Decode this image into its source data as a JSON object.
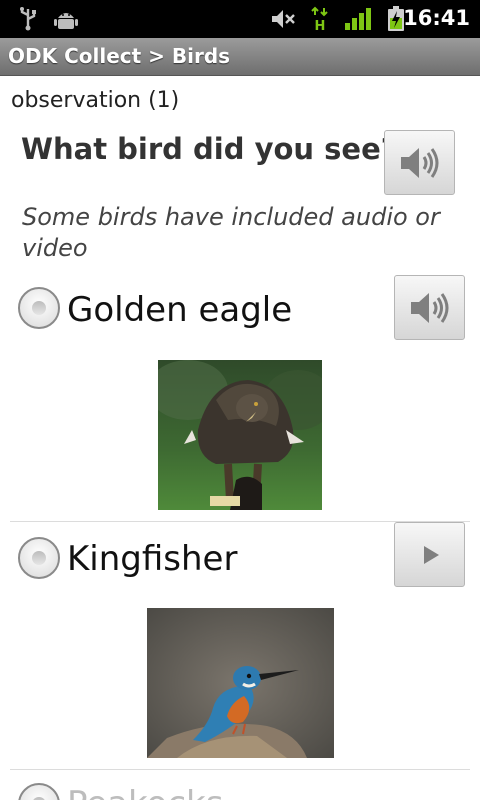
{
  "status_bar": {
    "time": "16:41",
    "icons": [
      "usb-icon",
      "android-debug-icon",
      "mute-icon",
      "hspa-data-icon",
      "signal-icon",
      "battery-charging-icon"
    ],
    "network_label": "H"
  },
  "title_bar": {
    "title": "ODK Collect > Birds"
  },
  "form": {
    "group_label": "observation (1)",
    "question": "What bird did you see?",
    "hint": "Some birds have included audio or video",
    "options": [
      {
        "label": "Golden eagle",
        "media_button": "audio-play-icon",
        "image": "golden-eagle-photo"
      },
      {
        "label": "Kingfisher",
        "media_button": "video-play-icon",
        "image": "kingfisher-photo"
      },
      {
        "label": "Peakocks",
        "media_button": "",
        "image": ""
      }
    ]
  },
  "colors": {
    "status_bar_bg": "#000000",
    "title_bar_bg": "#7f7f7f",
    "signal_green": "#7ec614"
  }
}
